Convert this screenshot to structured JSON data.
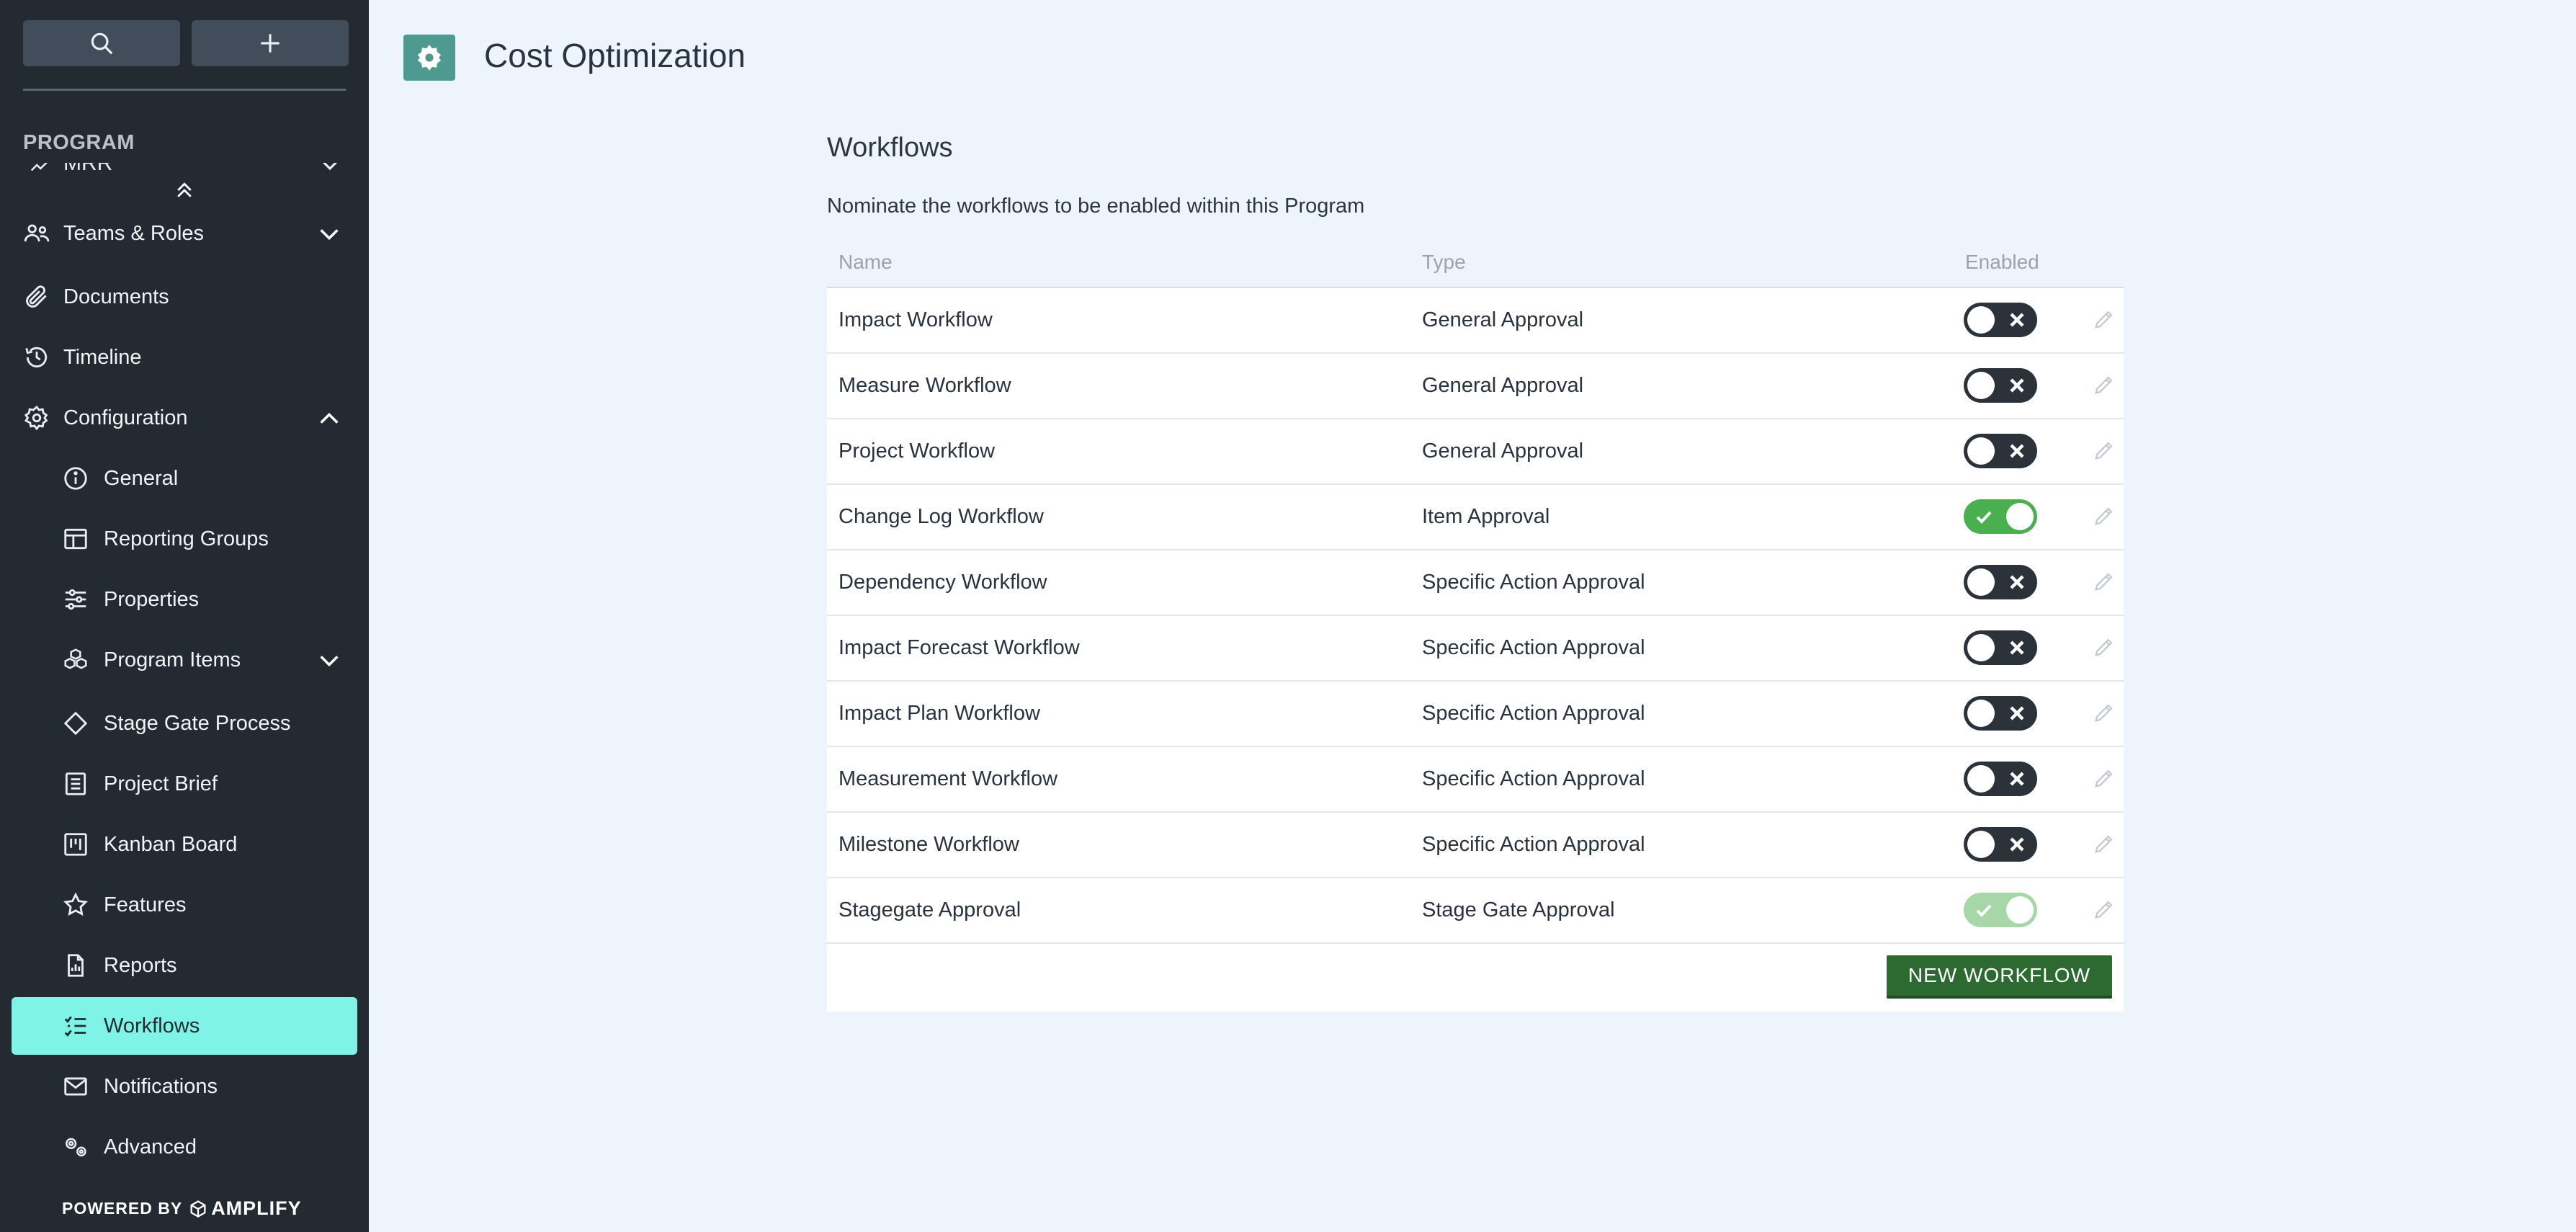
{
  "sidebar": {
    "search_icon": "search-icon",
    "add_icon": "plus-icon",
    "section_label": "PROGRAM",
    "clipped_item_label": "MRR",
    "items": [
      {
        "label": "Teams & Roles",
        "icon": "users-icon",
        "chevron": "down"
      },
      {
        "label": "Documents",
        "icon": "paperclip-icon"
      },
      {
        "label": "Timeline",
        "icon": "history-icon"
      },
      {
        "label": "Configuration",
        "icon": "gear-icon",
        "chevron": "up"
      }
    ],
    "config_items": [
      {
        "label": "General",
        "icon": "info-icon"
      },
      {
        "label": "Reporting Groups",
        "icon": "table-icon"
      },
      {
        "label": "Properties",
        "icon": "sliders-icon"
      },
      {
        "label": "Program Items",
        "icon": "cubes-icon",
        "chevron": "down"
      },
      {
        "label": "Stage Gate Process",
        "icon": "diamond-icon"
      },
      {
        "label": "Project Brief",
        "icon": "list-card-icon"
      },
      {
        "label": "Kanban Board",
        "icon": "kanban-icon"
      },
      {
        "label": "Features",
        "icon": "star-icon"
      },
      {
        "label": "Reports",
        "icon": "file-chart-icon"
      },
      {
        "label": "Workflows",
        "icon": "checklist-icon",
        "active": true
      },
      {
        "label": "Notifications",
        "icon": "envelope-icon"
      },
      {
        "label": "Advanced",
        "icon": "gears-icon"
      }
    ],
    "powered_by": "POWERED BY",
    "brand": "AMPLIFY"
  },
  "header": {
    "title": "Cost Optimization",
    "icon": "gear-icon"
  },
  "main": {
    "section_title": "Workflows",
    "description": "Nominate the workflows to be enabled within this Program",
    "columns": {
      "name": "Name",
      "type": "Type",
      "enabled": "Enabled"
    },
    "rows": [
      {
        "name": "Impact Workflow",
        "type": "General Approval",
        "enabled": false
      },
      {
        "name": "Measure Workflow",
        "type": "General Approval",
        "enabled": false
      },
      {
        "name": "Project Workflow",
        "type": "General Approval",
        "enabled": false
      },
      {
        "name": "Change Log Workflow",
        "type": "Item Approval",
        "enabled": true
      },
      {
        "name": "Dependency Workflow",
        "type": "Specific Action Approval",
        "enabled": false
      },
      {
        "name": "Impact Forecast Workflow",
        "type": "Specific Action Approval",
        "enabled": false
      },
      {
        "name": "Impact Plan Workflow",
        "type": "Specific Action Approval",
        "enabled": false
      },
      {
        "name": "Measurement Workflow",
        "type": "Specific Action Approval",
        "enabled": false
      },
      {
        "name": "Milestone Workflow",
        "type": "Specific Action Approval",
        "enabled": false
      },
      {
        "name": "Stagegate Approval",
        "type": "Stage Gate Approval",
        "enabled": true,
        "disabled": true
      }
    ],
    "new_button": "NEW WORKFLOW"
  },
  "colors": {
    "sidebar_bg": "#232a31",
    "active_item_bg": "#7ff4e6",
    "page_bg": "#eef4fc",
    "toggle_on": "#4ab04f",
    "toggle_off": "#2b323a",
    "primary_button": "#2d6a31",
    "header_icon_bg": "#4f9a90"
  }
}
